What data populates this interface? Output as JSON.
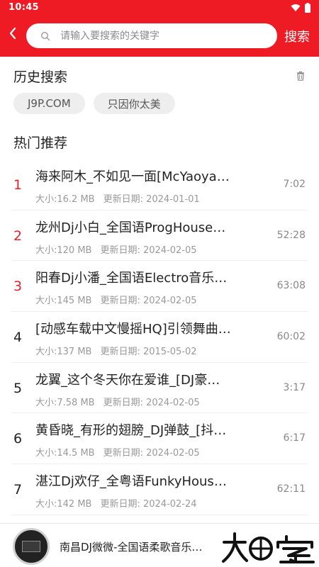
{
  "status_bar": {
    "time": "10:45"
  },
  "search": {
    "placeholder": "请输入要搜索的关键字",
    "button_label": "搜索"
  },
  "history": {
    "title": "历史搜索",
    "tags": [
      "J9P.COM",
      "只因你太美"
    ]
  },
  "hot": {
    "title": "热门推荐",
    "items": [
      {
        "rank": "1",
        "title": "海来阿木_不如见一面[McYaoya…",
        "size": "大小:16.2 MB",
        "date": "更新日期: 2024-01-01",
        "duration": "7:02"
      },
      {
        "rank": "2",
        "title": "龙州Dj小白_全国语ProgHouse…",
        "size": "大小:120 MB",
        "date": "更新日期: 2024-02-05",
        "duration": "52:28"
      },
      {
        "rank": "3",
        "title": "阳春Dj小潘_全国语Electro音乐…",
        "size": "大小:145 MB",
        "date": "更新日期: 2024-02-05",
        "duration": "63:08"
      },
      {
        "rank": "4",
        "title": "[动感车载中文慢摇HQ]引领舞曲…",
        "size": "大小:137 MB",
        "date": "更新日期: 2015-05-02",
        "duration": "60:02"
      },
      {
        "rank": "5",
        "title": "龙翼_这个冬天你在爱谁_[DJ豪…",
        "size": "大小:7.58 MB",
        "date": "更新日期: 2024-02-05",
        "duration": "3:17"
      },
      {
        "rank": "6",
        "title": "黄昏晓_有形的翅膀_DJ弹鼓_[抖…",
        "size": "大小:14.5 MB",
        "date": "更新日期: 2024-02-05",
        "duration": "6:17"
      },
      {
        "rank": "7",
        "title": "湛江Dj欢仔_全粤语FunkyHous…",
        "size": "大小:142 MB",
        "date": "更新日期: 2024-02-24",
        "duration": "62:11"
      }
    ]
  },
  "player": {
    "title": "南昌DJ微微-全国语柔歌音乐…"
  },
  "colors": {
    "brand": "#ee1b24",
    "rank_highlight": "#e8202a"
  },
  "icons": [
    "back-arrow-icon",
    "search-icon",
    "trash-icon",
    "wifi-icon",
    "battery-icon"
  ]
}
